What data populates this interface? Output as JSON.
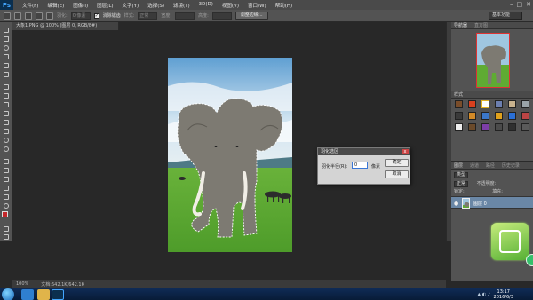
{
  "app": {
    "logo": "Ps",
    "menus": [
      "文件(F)",
      "编辑(E)",
      "图像(I)",
      "图层(L)",
      "文字(Y)",
      "选择(S)",
      "滤镜(T)",
      "3D(D)",
      "视图(V)",
      "窗口(W)",
      "帮助(H)"
    ],
    "window_controls": [
      "–",
      "□",
      "✕"
    ]
  },
  "options": {
    "feather_label": "羽化:",
    "feather_value": "0 像素",
    "antialias_label": "消除锯齿",
    "style_label": "样式:",
    "style_value": "正常",
    "width_label": "宽度:",
    "height_label": "高度:",
    "refine_edge": "调整边缘...",
    "workspace": "基本功能"
  },
  "document": {
    "tab": "大象1.PNG @ 100% (图层 0, RGB/8#)"
  },
  "status": {
    "zoom": "100%",
    "doc_info": "文档:642.1K/642.1K"
  },
  "dialog": {
    "title": "羽化选区",
    "label": "羽化半径(R):",
    "value": "0",
    "unit": "像素",
    "ok": "确定",
    "cancel": "取消",
    "close": "x"
  },
  "panels": {
    "navigator_tabs": [
      "导航器",
      "直方图"
    ],
    "styles_tab": "样式",
    "styles_colors": [
      "#7a4d2a",
      "#d8401f",
      "#ffffff",
      "#6c7fb0",
      "#c8b28e",
      "#9aa3a8",
      "#3a3a3a",
      "#d28a28",
      "#3b77c9",
      "#e0a11c",
      "#2a6fd6",
      "#b44",
      "#eeeeee",
      "#6a4a2a",
      "#7d3ea8",
      "#4b4b4b",
      "#2f2f2f",
      "#5a5a5a"
    ],
    "layers_tabs": [
      "图层",
      "通道",
      "路径",
      "历史记录"
    ],
    "layer_kind": "类型",
    "blend_mode": "正常",
    "opacity_label": "不透明度:",
    "lock_label": "锁定:",
    "fill_label": "填充:",
    "layer_name": "图层 0"
  },
  "taskbar": {
    "time": "13:17",
    "date": "2016/6/3",
    "apps": [
      "ie-icon",
      "folder-icon",
      "photoshop-icon"
    ]
  },
  "colors": {
    "foreground": "#c3272b",
    "background": "#ffffff",
    "selection_layer": "#6a87a6"
  }
}
